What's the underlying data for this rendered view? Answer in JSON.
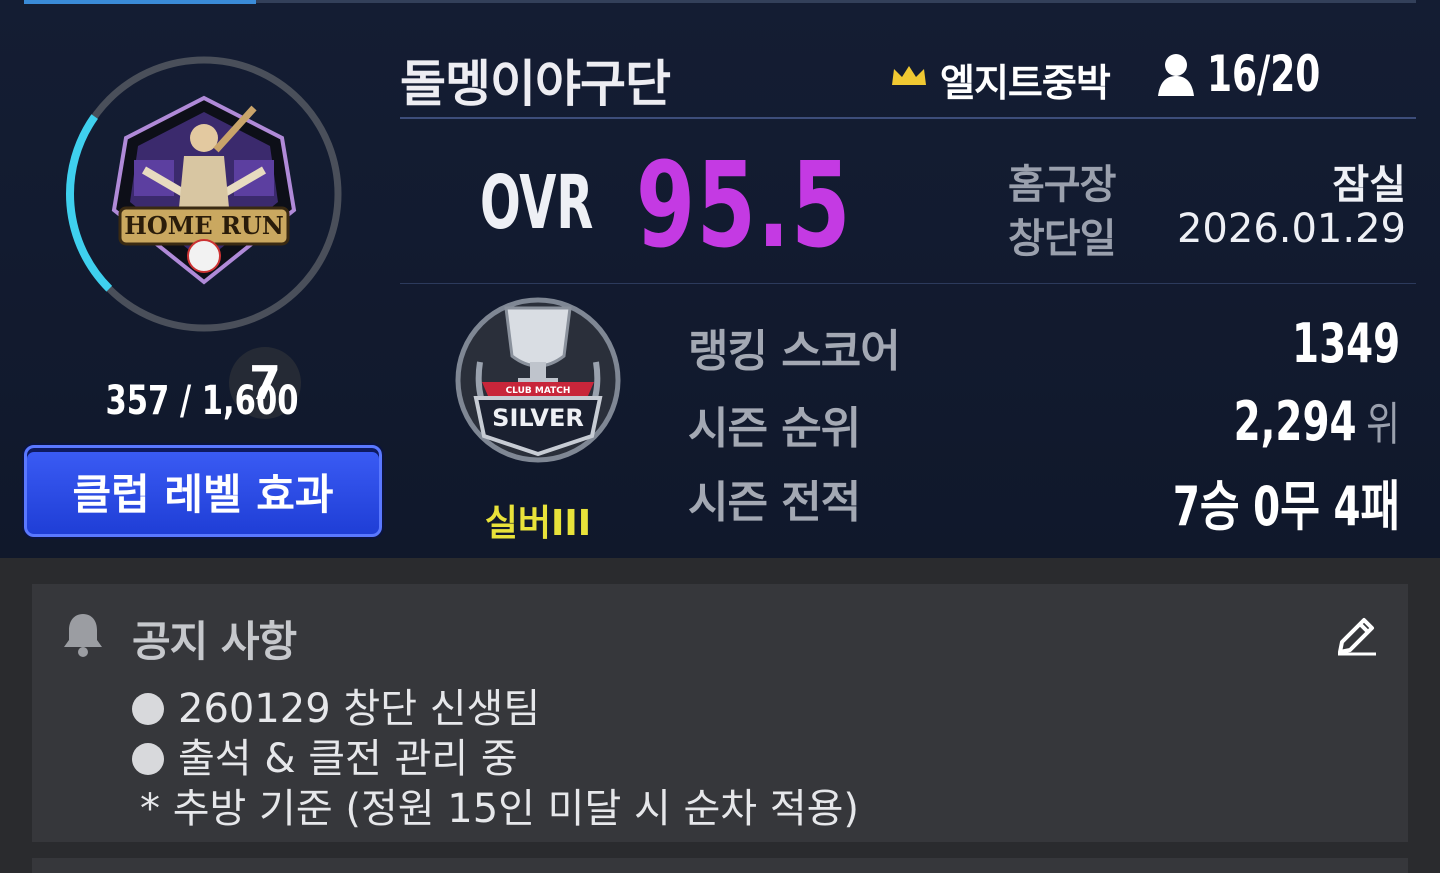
{
  "club": {
    "name": "돌멩이야구단",
    "master": "엘지트중박",
    "members": "16/20"
  },
  "level": {
    "value": "7",
    "exp_text": "357 / 1,600",
    "progress": 0.223,
    "button_label": "클럽 레벨 효과"
  },
  "emblem": {
    "text": "HOME RUN"
  },
  "ovr": {
    "label": "OVR",
    "value": "95.5"
  },
  "info": {
    "home_label": "홈구장",
    "home_value": "잠실",
    "founded_label": "창단일",
    "founded_value": "2026.01.29"
  },
  "tier": {
    "badge_text": "SILVER",
    "ribbon_text": "CLUB MATCH",
    "name": "실버III"
  },
  "stats": {
    "ranking_label": "랭킹 스코어",
    "ranking_value": "1349",
    "season_rank_label": "시즌 순위",
    "season_rank_value": "2,294",
    "season_rank_unit": "위",
    "season_record_label": "시즌 전적",
    "season_record_value": "7승 0무 4패"
  },
  "notice": {
    "title": "공지 사항",
    "lines": [
      "260129 창단 신생팀",
      "출석 & 클전 관리 중",
      "* 추방 기준 (정원 15인 미달 시 순차 적용)"
    ]
  },
  "colors": {
    "ovr": "#c43ae3",
    "tier": "#e8e23a",
    "button": "#2a48e6",
    "progress": "#3fd0ee"
  }
}
